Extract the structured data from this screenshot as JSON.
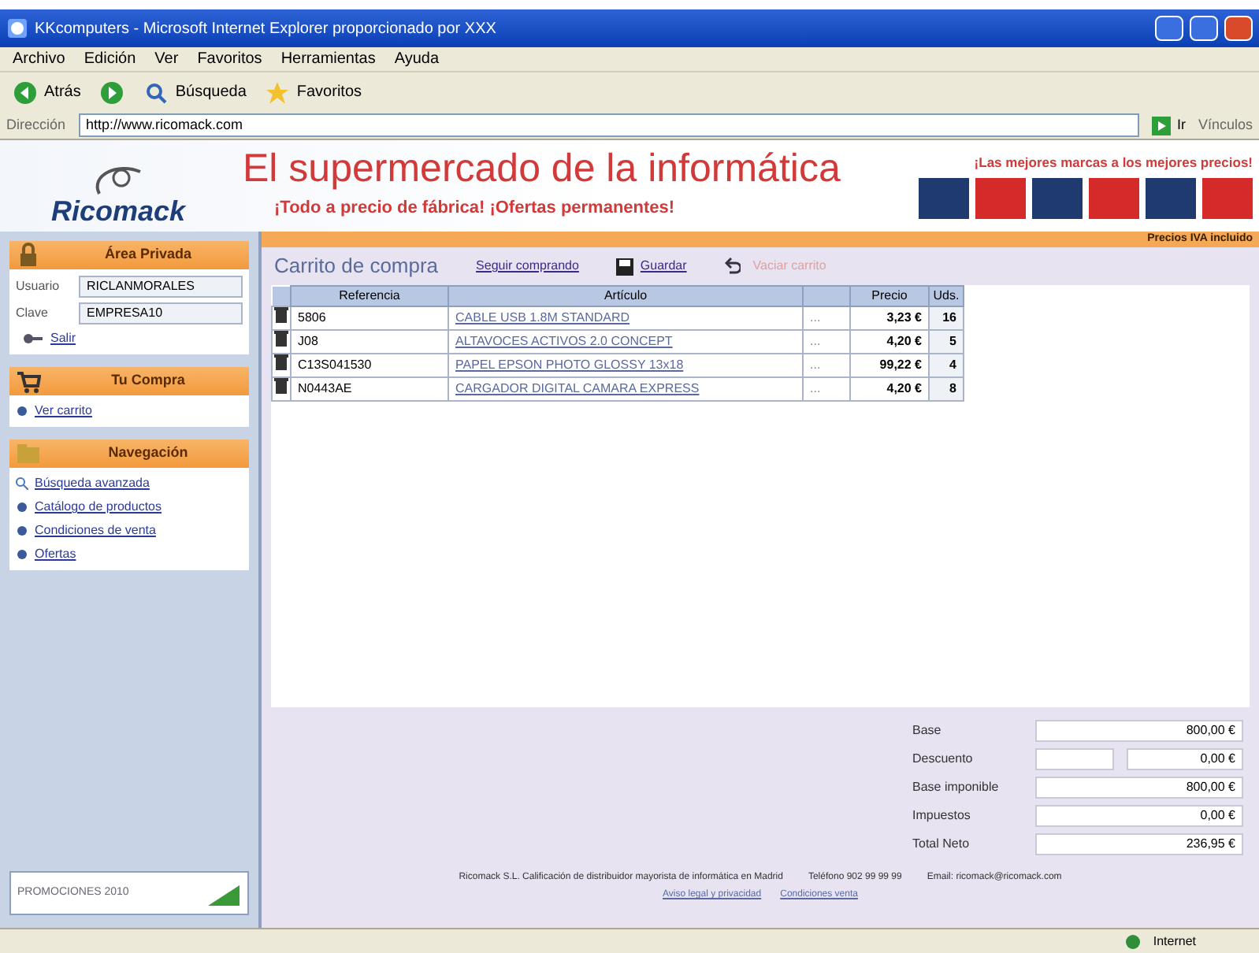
{
  "window": {
    "title": "KKcomputers - Microsoft Internet Explorer proporcionado por XXX"
  },
  "menu": [
    "Archivo",
    "Edición",
    "Ver",
    "Favoritos",
    "Herramientas",
    "Ayuda"
  ],
  "toolbar": [
    {
      "kind": "back",
      "label": "Atrás"
    },
    {
      "kind": "forward"
    },
    {
      "kind": "search",
      "label": "Búsqueda"
    },
    {
      "kind": "favorites",
      "label": "Favoritos"
    }
  ],
  "address": {
    "label": "Dirección",
    "value": "http://www.ricomack.com",
    "go": "Ir",
    "links": "Vínculos"
  },
  "header": {
    "logo": "Ricomack",
    "headline": "El supermercado de la informática",
    "subline": "¡Todo a precio de fábrica! ¡Ofertas permanentes!",
    "brands_title": "¡Las mejores marcas a los mejores precios!",
    "brands": [
      {
        "color": "#1f3a6e"
      },
      {
        "color": "#d42a2a"
      },
      {
        "color": "#1f3a6e"
      },
      {
        "color": "#d42a2a"
      },
      {
        "color": "#1f3a6e"
      },
      {
        "color": "#d42a2a"
      }
    ],
    "notice": "Precios IVA incluido"
  },
  "sidebar": [
    {
      "kind": "login",
      "title": "Área Privada",
      "fields": [
        {
          "label": "Usuario",
          "value": "RICLANMORALES"
        },
        {
          "label": "Clave",
          "value": "EMPRESA10"
        }
      ],
      "link": "Salir"
    },
    {
      "kind": "cart",
      "title": "Tu Compra",
      "links": [
        "Ver carrito"
      ]
    },
    {
      "kind": "nav",
      "title": "Navegación",
      "links": [
        "Búsqueda avanzada",
        "Catálogo de productos",
        "Condiciones de venta",
        "Ofertas"
      ]
    }
  ],
  "promo": {
    "text": "PROMOCIONES 2010"
  },
  "cart": {
    "title": "Carrito de compra",
    "actions": [
      {
        "kind": "link",
        "label": "Seguir comprando"
      },
      {
        "kind": "save",
        "label": "Guardar"
      },
      {
        "kind": "disabled",
        "label": "Vaciar carrito"
      }
    ],
    "columns": [
      "Referencia",
      "Artículo",
      "",
      "Precio",
      "Uds."
    ],
    "rows": [
      {
        "ref": "5806",
        "article": "CABLE USB 1.8M STANDARD",
        "more": "...",
        "price": "3,23 €",
        "qty": "16"
      },
      {
        "ref": "J08",
        "article": "ALTAVOCES ACTIVOS 2.0 CONCEPT",
        "more": "...",
        "price": "4,20 €",
        "qty": "5"
      },
      {
        "ref": "C13S041530",
        "article": "PAPEL EPSON PHOTO GLOSSY 13x18",
        "more": "...",
        "price": "99,22 €",
        "qty": "4"
      },
      {
        "ref": "N0443AE",
        "article": "CARGADOR DIGITAL CAMARA EXPRESS",
        "more": "...",
        "price": "4,20 €",
        "qty": "8"
      }
    ]
  },
  "totals": [
    {
      "label": "Base",
      "value": "800,00 €"
    },
    {
      "label": "Descuento",
      "kind": "discount",
      "value": "0,00 €"
    },
    {
      "label": "Base imponible",
      "value": "800,00 €"
    },
    {
      "label": "Impuestos",
      "value": "0,00 €"
    },
    {
      "label": "Total Neto",
      "value": "236,95 €"
    }
  ],
  "footer": {
    "text": "Ricomack S.L. Calificación de distribuidor mayorista de informática en Madrid",
    "phone": "Teléfono 902 99 99 99",
    "email": "Email: ricomack@ricomack.com",
    "links": [
      "Aviso legal y privacidad",
      "Condiciones venta"
    ]
  },
  "status_bar": {
    "zone": "Internet"
  }
}
